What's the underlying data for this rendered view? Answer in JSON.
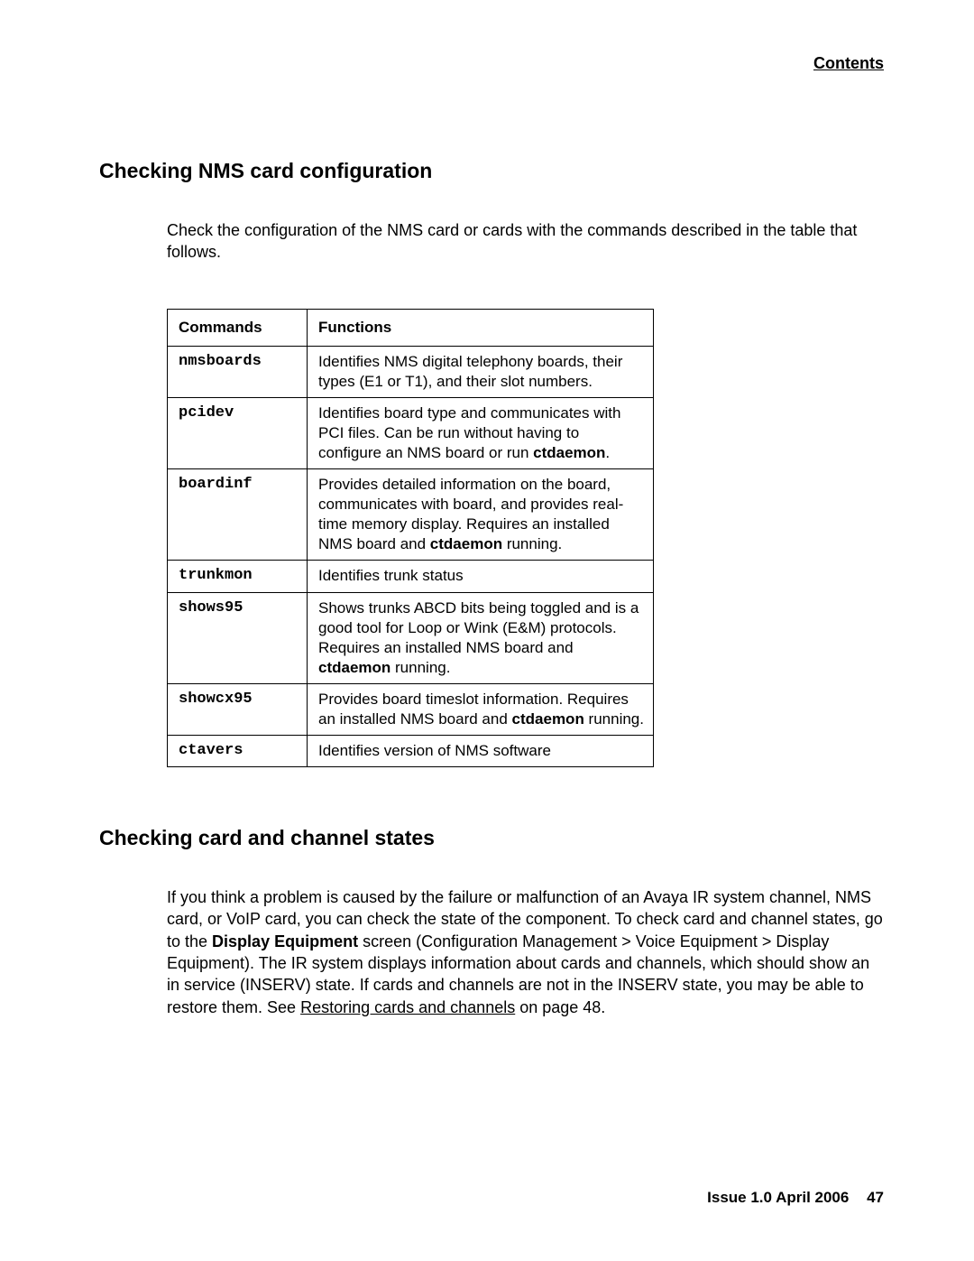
{
  "header_link": "Contents",
  "section1": {
    "title": "Checking NMS card configuration",
    "intro": "Check the configuration of the NMS card or cards with the commands described in the table that follows."
  },
  "table": {
    "col1": "Commands",
    "col2": "Functions",
    "rows": [
      {
        "cmd": "nmsboards",
        "func_pre": "Identifies NMS digital telephony boards, their types (E1 or T1), and their slot numbers.",
        "bold": "",
        "func_post": ""
      },
      {
        "cmd": "pcidev",
        "func_pre": "Identifies board type and communicates with PCI files. Can be run without having to configure an NMS board or run ",
        "bold": "ctdaemon",
        "func_post": "."
      },
      {
        "cmd": "boardinf",
        "func_pre": "Provides detailed information on the board, communicates with board, and provides real-time memory display. Requires an installed NMS board and ",
        "bold": "ctdaemon",
        "func_post": " running."
      },
      {
        "cmd": "trunkmon",
        "func_pre": "Identifies trunk status",
        "bold": "",
        "func_post": ""
      },
      {
        "cmd": "shows95",
        "func_pre": "Shows trunks ABCD bits being toggled and is a good tool for Loop or Wink (E&M) protocols. Requires an installed NMS board and ",
        "bold": "ctdaemon",
        "func_post": " running."
      },
      {
        "cmd": "showcx95",
        "func_pre": "Provides board timeslot information. Requires an installed NMS board and ",
        "bold": "ctdaemon",
        "func_post": " running."
      },
      {
        "cmd": "ctavers",
        "func_pre": "Identifies version of NMS software",
        "bold": "",
        "func_post": ""
      }
    ]
  },
  "section2": {
    "title": "Checking card and channel states",
    "para_pre": "If you think a problem is caused by the failure or malfunction of an Avaya IR system channel, NMS card, or VoIP card, you can check the state of the component. To check card and channel states, go to the ",
    "bold1": "Display Equipment",
    "para_mid": " screen (Configuration Management > Voice Equipment > Display Equipment). The IR system displays information about cards and channels, which should show an in service (INSERV) state. If cards and channels are not in the INSERV state, you may be able to restore them. See ",
    "link": "Restoring cards and channels",
    "para_post": " on page 48."
  },
  "footer": {
    "text": "Issue 1.0   April 2006",
    "page": "47"
  }
}
